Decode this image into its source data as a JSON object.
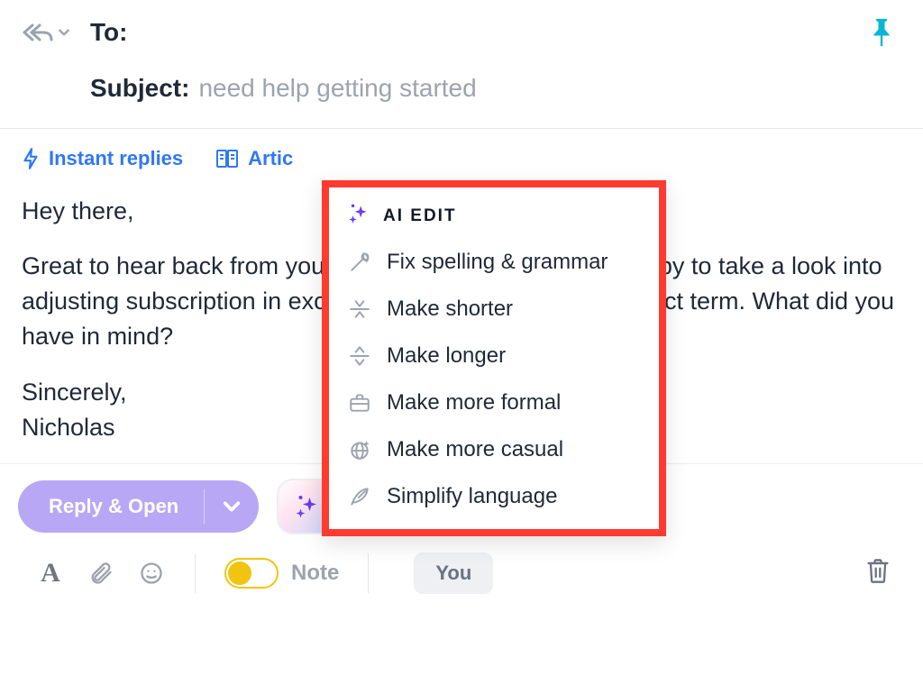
{
  "header": {
    "to_label": "To:",
    "subject_label": "Subject:",
    "subject_value": "need help getting started"
  },
  "tabs": {
    "instant_replies": "Instant replies",
    "articles": "Artic"
  },
  "body": {
    "greeting": "Hey there,",
    "paragraph": "Great to hear back from you all so fast. Yes, I would be happy to take a look into adjusting subscription in exchange again for a longer contract term. What did you have in mind?",
    "signoff": "Sincerely,",
    "signature": "Nicholas"
  },
  "ai_edit": {
    "title": "AI EDIT",
    "items": [
      "Fix spelling & grammar",
      "Make shorter",
      "Make longer",
      "Make more formal",
      "Make more casual",
      "Simplify language"
    ]
  },
  "actions": {
    "reply_open": "Reply & Open"
  },
  "toolbar": {
    "note_label": "Note",
    "you_label": "You"
  }
}
